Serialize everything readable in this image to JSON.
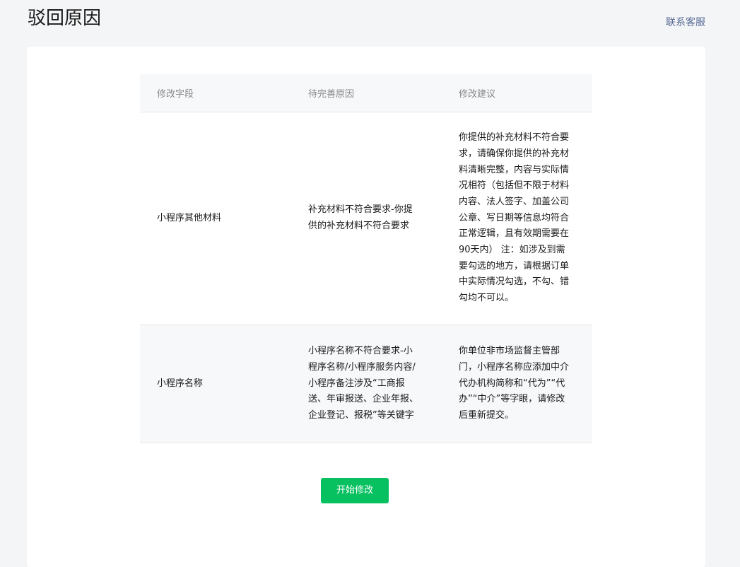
{
  "header": {
    "title": "驳回原因",
    "contact_label": "联系客服"
  },
  "table": {
    "columns": [
      "修改字段",
      "待完善原因",
      "修改建议"
    ],
    "rows": [
      {
        "field": "小程序其他材料",
        "reason": "补充材料不符合要求-你提供的补充材料不符合要求",
        "suggestion": "你提供的补充材料不符合要求，请确保你提供的补充材料清晰完整，内容与实际情况相符（包括但不限于材料内容、法人签字、加盖公司公章、写日期等信息均符合正常逻辑，且有效期需要在90天内） 注：如涉及到需要勾选的地方，请根据订单中实际情况勾选，不勾、错勾均不可以。"
      },
      {
        "field": "小程序名称",
        "reason": "小程序名称不符合要求-小程序名称/小程序服务内容/小程序备注涉及“工商报送、年审报送、企业年报、企业登记、报税”等关键字",
        "suggestion": "你单位非市场监督主管部门，小程序名称应添加中介代办机构简称和“代为”“代办”“中介”等字眼，请修改后重新提交。"
      }
    ]
  },
  "actions": {
    "start_label": "开始修改"
  },
  "colors": {
    "accent": "#07c160",
    "link": "#576b95",
    "background": "#f4f5f7",
    "header_row": "#f7f8fa"
  }
}
